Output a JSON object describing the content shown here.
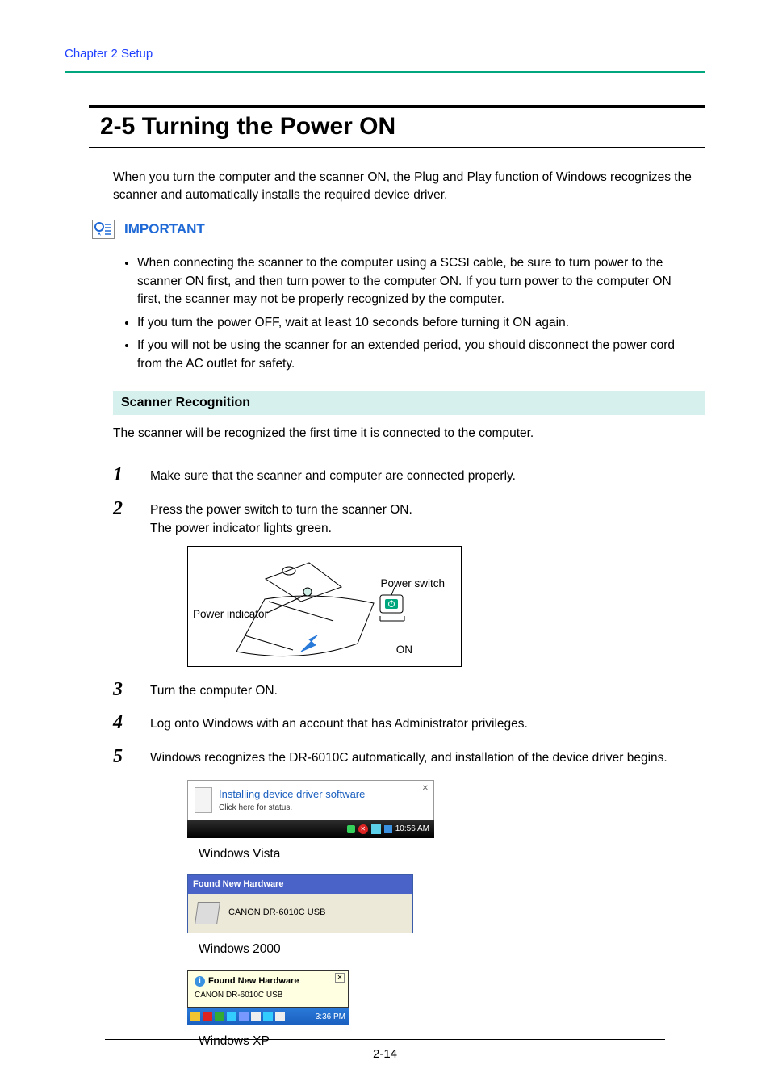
{
  "header": {
    "breadcrumb": "Chapter 2    Setup"
  },
  "title": "2-5  Turning the Power ON",
  "intro": "When you turn the computer and the scanner ON, the Plug and Play function of Windows recognizes the scanner and automatically installs the required device driver.",
  "important": {
    "label": "IMPORTANT",
    "items": [
      "When connecting the scanner to the computer using a SCSI cable, be sure to turn power to the scanner ON first, and then turn power to the computer ON. If you turn power to the computer ON first, the scanner may not be properly recognized by the computer.",
      "If you turn the power OFF, wait at least 10 seconds before turning it ON again.",
      "If you will not be using the scanner for an extended period, you should disconnect the power cord from the AC outlet for safety."
    ]
  },
  "section": {
    "heading": "Scanner Recognition",
    "lead": "The scanner will be recognized the first time it is connected to the computer."
  },
  "steps": {
    "s1": "Make sure that the scanner and computer are connected properly.",
    "s2a": "Press the power switch to turn the scanner ON.",
    "s2b": "The power indicator lights green.",
    "s3": "Turn the computer ON.",
    "s4": "Log onto Windows with an account that has Administrator privileges.",
    "s5": "Windows recognizes the DR-6010C automatically, and installation of the device driver begins."
  },
  "diagram_labels": {
    "power_indicator": "Power indicator",
    "power_switch": "Power switch",
    "on": "ON"
  },
  "screenshots": {
    "vista": {
      "balloon_title": "Installing device driver software",
      "balloon_sub": "Click here for status.",
      "clock": "10:56 AM",
      "caption": "Windows Vista"
    },
    "w2k": {
      "title": "Found New Hardware",
      "body": "CANON   DR-6010C USB",
      "caption": "Windows 2000"
    },
    "wxp": {
      "balloon_title": "Found New Hardware",
      "balloon_body": "CANON DR-6010C USB",
      "clock": "3:36 PM",
      "caption": "Windows XP"
    }
  },
  "page_number": "2-14"
}
